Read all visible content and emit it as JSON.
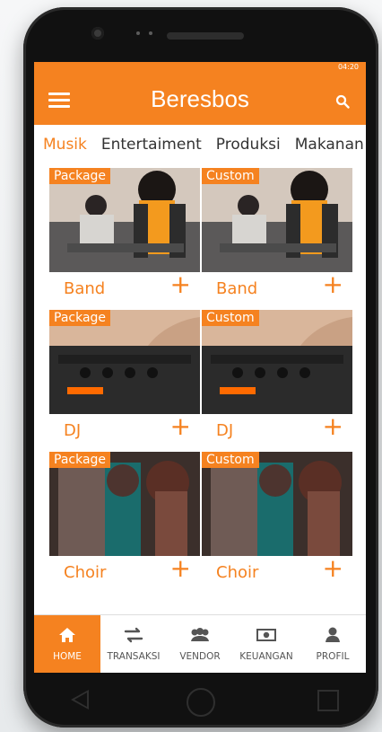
{
  "app": {
    "title": "Beresbos",
    "status_text": "04:20"
  },
  "tabs": [
    {
      "label": "Musik",
      "active": true
    },
    {
      "label": "Entertaiment",
      "active": false
    },
    {
      "label": "Produksi",
      "active": false
    },
    {
      "label": "Makanan",
      "active": false
    }
  ],
  "cards": [
    {
      "badge": "Package",
      "name": "Band"
    },
    {
      "badge": "Custom",
      "name": "Band"
    },
    {
      "badge": "Package",
      "name": "DJ"
    },
    {
      "badge": "Custom",
      "name": "DJ"
    },
    {
      "badge": "Package",
      "name": "Choir"
    },
    {
      "badge": "Custom",
      "name": "Choir"
    }
  ],
  "nav": [
    {
      "label": "HOME",
      "icon": "home-icon",
      "active": true
    },
    {
      "label": "TRANSAKSI",
      "icon": "transfer-icon",
      "active": false
    },
    {
      "label": "VENDOR",
      "icon": "group-icon",
      "active": false
    },
    {
      "label": "KEUANGAN",
      "icon": "money-icon",
      "active": false
    },
    {
      "label": "PROFIL",
      "icon": "person-icon",
      "active": false
    }
  ],
  "colors": {
    "accent": "#f58220",
    "text": "#333333",
    "nav_text": "#555555"
  }
}
